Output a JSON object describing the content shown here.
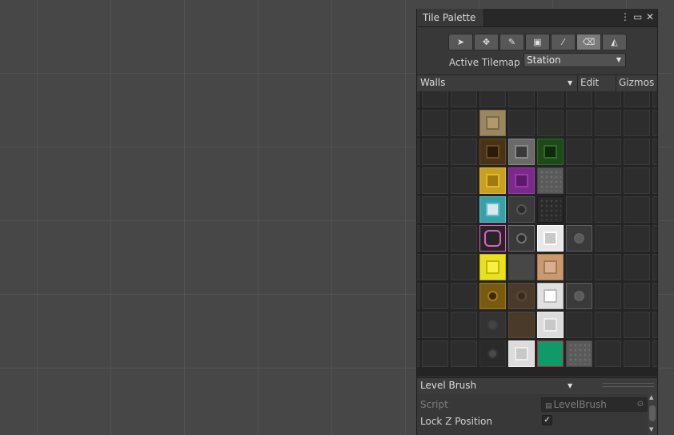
{
  "window": {
    "tab_title": "Tile Palette",
    "menu_icon": "kebab-icon",
    "maximize_icon": "maximize-icon",
    "close_icon": "close-icon"
  },
  "toolbar": [
    {
      "name": "select-tool",
      "glyph": "➤",
      "active": false
    },
    {
      "name": "move-tool",
      "glyph": "✥",
      "active": false
    },
    {
      "name": "paint-tool",
      "glyph": "✎",
      "active": false
    },
    {
      "name": "box-fill-tool",
      "glyph": "▣",
      "active": false
    },
    {
      "name": "picker-tool",
      "glyph": "⁄",
      "active": false
    },
    {
      "name": "eraser-tool",
      "glyph": "⌫",
      "active": true
    },
    {
      "name": "fill-tool",
      "glyph": "◭",
      "active": false
    }
  ],
  "active_tilemap": {
    "label": "Active Tilemap",
    "value": "Station"
  },
  "palette_bar": {
    "palette": "Walls",
    "edit": "Edit",
    "gizmos": "Gizmos"
  },
  "brush": {
    "label": "Level Brush"
  },
  "properties": {
    "script_label": "Script",
    "script_value": "LevelBrush",
    "lock_z_label": "Lock Z Position",
    "lock_z_checked": true
  },
  "colors": {
    "panel": "#383838",
    "scene": "#474747",
    "grid_bg": "#2d2d2d"
  },
  "tiles": [
    {
      "row": 0,
      "col": 2,
      "bg": "#9a8660",
      "inner": "#b09a6c",
      "border": "#7a6a4a",
      "kind": "square"
    },
    {
      "row": 1,
      "col": 2,
      "bg": "#4a3218",
      "inner": "#2a1a08",
      "border": "#6a4a20",
      "kind": "square"
    },
    {
      "row": 1,
      "col": 3,
      "bg": "#6a6a6a",
      "inner": "#3a3a3a",
      "border": "#888888",
      "kind": "square"
    },
    {
      "row": 1,
      "col": 4,
      "bg": "#1e4a1a",
      "inner": "#0e2a0c",
      "border": "#2e6a28",
      "kind": "square"
    },
    {
      "row": 2,
      "col": 2,
      "bg": "#c8a020",
      "inner": "#a07a10",
      "border": "#e0b830",
      "kind": "square"
    },
    {
      "row": 2,
      "col": 3,
      "bg": "#7a2a8a",
      "inner": "#5a1a6a",
      "border": "#9a3aaa",
      "kind": "square"
    },
    {
      "row": 2,
      "col": 4,
      "bg": "#5a5a5a",
      "inner": "#6e6e6e",
      "border": "#4a4a4a",
      "kind": "rock"
    },
    {
      "row": 3,
      "col": 2,
      "bg": "#3aa0a8",
      "inner": "#d8e8ea",
      "border": "#60c0c8",
      "kind": "square"
    },
    {
      "row": 3,
      "col": 3,
      "bg": "#3a3a3a",
      "inner": "#2a2a2a",
      "border": "#555555",
      "kind": "ring"
    },
    {
      "row": 3,
      "col": 4,
      "bg": "#2a2a2a",
      "inner": "#444444",
      "border": "#1a1a1a",
      "kind": "rock"
    },
    {
      "row": 4,
      "col": 2,
      "bg": "#262626",
      "inner": "#262626",
      "border": "#e060c0",
      "kind": "octagon"
    },
    {
      "row": 4,
      "col": 3,
      "bg": "#3a3a3a",
      "inner": "#2c2c2c",
      "border": "#707070",
      "kind": "ring"
    },
    {
      "row": 4,
      "col": 4,
      "bg": "#e8e8e8",
      "inner": "#c8c8c8",
      "border": "#ffffff",
      "kind": "square"
    },
    {
      "row": 4,
      "col": 5,
      "bg": "#3a3a3a",
      "inner": "#5a5a5a",
      "border": "#606060",
      "kind": "ring"
    },
    {
      "row": 5,
      "col": 2,
      "bg": "#e8e020",
      "inner": "#f8f040",
      "border": "#c0b800",
      "kind": "square"
    },
    {
      "row": 5,
      "col": 3,
      "bg": "#474747",
      "inner": "#474747",
      "border": "#404040",
      "kind": "plain"
    },
    {
      "row": 5,
      "col": 4,
      "bg": "#c89a70",
      "inner": "#d8b090",
      "border": "#a87a50",
      "kind": "square"
    },
    {
      "row": 6,
      "col": 2,
      "bg": "#7a5a10",
      "inner": "#3a2a08",
      "border": "#a07a20",
      "kind": "ring"
    },
    {
      "row": 6,
      "col": 3,
      "bg": "#4a3a2a",
      "inner": "#3a2a1a",
      "border": "#5a4a3a",
      "kind": "ring"
    },
    {
      "row": 6,
      "col": 4,
      "bg": "#e0e0e0",
      "inner": "#ffffff",
      "border": "#bbbbbb",
      "kind": "square"
    },
    {
      "row": 6,
      "col": 5,
      "bg": "#3a3a3a",
      "inner": "#5a5a5a",
      "border": "#606060",
      "kind": "ring"
    },
    {
      "row": 7,
      "col": 2,
      "bg": "#333333",
      "inner": "#444444",
      "border": "#3c3c3c",
      "kind": "ring"
    },
    {
      "row": 7,
      "col": 3,
      "bg": "#4a3a2a",
      "inner": "#3a2a1a",
      "border": "#5a4a3a",
      "kind": "plain"
    },
    {
      "row": 7,
      "col": 4,
      "bg": "#dcdcdc",
      "inner": "#c8c8c8",
      "border": "#eeeeee",
      "kind": "square"
    },
    {
      "row": 8,
      "col": 2,
      "bg": "#2a2a2a",
      "inner": "#4a4a4a",
      "border": "#333333",
      "kind": "ring"
    },
    {
      "row": 8,
      "col": 3,
      "bg": "#dcdcdc",
      "inner": "#c8c8c8",
      "border": "#eeeeee",
      "kind": "square"
    },
    {
      "row": 8,
      "col": 4,
      "bg": "#109a6a",
      "inner": "#109a6a",
      "border": "#c02040",
      "kind": "plain"
    },
    {
      "row": 8,
      "col": 5,
      "bg": "#5a5a5a",
      "inner": "#6e6e6e",
      "border": "#4a4a4a",
      "kind": "rock"
    }
  ]
}
